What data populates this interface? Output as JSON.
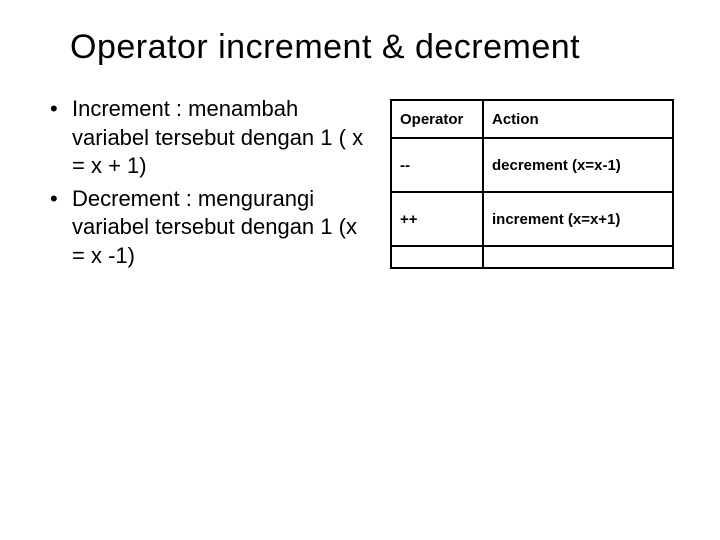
{
  "title": "Operator increment & decrement",
  "bullets": [
    "Increment : menambah variabel tersebut dengan 1 ( x = x + 1)",
    "Decrement : mengurangi variabel tersebut dengan 1 (x = x -1)"
  ],
  "table": {
    "headers": [
      "Operator",
      "Action"
    ],
    "rows": [
      {
        "operator": "--",
        "action": "decrement (x=x-1)"
      },
      {
        "operator": "++",
        "action": "increment (x=x+1)"
      }
    ]
  }
}
